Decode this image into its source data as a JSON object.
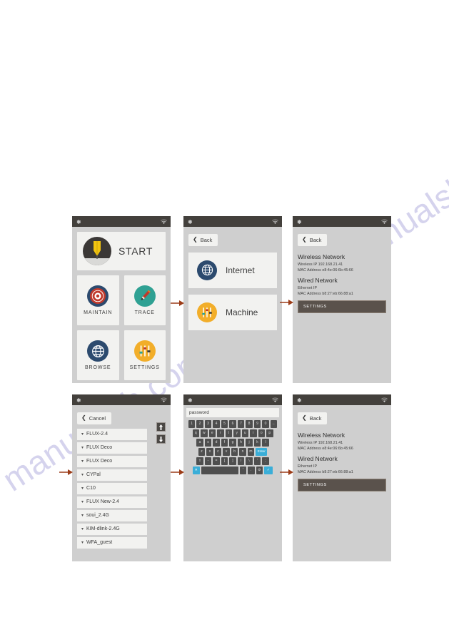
{
  "page": {
    "watermark_top": "manualslib.com",
    "watermark_bottom": "manualslib.com",
    "background": "#ffffff",
    "panel_bg": "#cfcfcf",
    "statusbar_bg": "#43403c",
    "accent_blue": "#3aaed8",
    "arrow_color": "#9c3c18"
  },
  "statusbar": {
    "gear_icon": "gear-icon",
    "wifi_icon": "wifi-icon"
  },
  "panel_home": {
    "name": "home-screen",
    "start": {
      "label": "START",
      "icon": "laser-head-icon"
    },
    "tiles": [
      {
        "label": "MAINTAIN",
        "icon": "target-icon",
        "color": "#2c4a6e"
      },
      {
        "label": "TRACE",
        "icon": "pencil-icon",
        "color": "#2fa193"
      },
      {
        "label": "BROWSE",
        "icon": "globe-icon",
        "color": "#2c4a6e"
      },
      {
        "label": "SETTINGS",
        "icon": "sliders-icon",
        "color": "#f2ae2a"
      }
    ]
  },
  "panel_menu": {
    "name": "network-type-screen",
    "back_label": "Back",
    "items": [
      {
        "label": "Internet",
        "icon": "globe-icon",
        "color": "#2c4a6e"
      },
      {
        "label": "Machine",
        "icon": "sliders-icon",
        "color": "#f2ae2a"
      }
    ]
  },
  "panel_info_top": {
    "name": "network-info-screen",
    "back_label": "Back",
    "wireless_heading": "Wireless Network",
    "wireless_ip": "Wireless IP 192.168.21.41",
    "wireless_mac": "MAC Address e8:4e:06:6b:45:66",
    "wired_heading": "Wired Network",
    "wired_ip": "Ethernet IP",
    "wired_mac": "MAC Address b8:27:eb:66:88:a1",
    "settings_label": "SETTINGS"
  },
  "panel_wifi_list": {
    "name": "wifi-list-screen",
    "cancel_label": "Cancel",
    "networks": [
      "FLUX-2.4",
      "FLUX Deco",
      "FLUX Deco",
      "CYPal",
      "C10",
      "FLUX New-2.4",
      "soui_2.4G",
      "KIM-dlink-2.4G",
      "WFA_guest"
    ],
    "scroll_up_icon": "arrow-up-icon",
    "scroll_down_icon": "arrow-down-icon"
  },
  "panel_keyboard": {
    "name": "password-keyboard-screen",
    "field_placeholder": "password",
    "field_value": "password",
    "rows": [
      [
        "1",
        "2",
        "3",
        "4",
        "5",
        "6",
        "7",
        "8",
        "9",
        "0",
        "←"
      ],
      [
        "q",
        "w",
        "e",
        "r",
        "t",
        "y",
        "u",
        "i",
        "o",
        "p"
      ],
      [
        "a",
        "s",
        "d",
        "f",
        "g",
        "h",
        "j",
        "k",
        "l"
      ],
      [
        "z",
        "x",
        "c",
        "v",
        "b",
        "n",
        "m",
        "Enter"
      ],
      [
        "⇧",
        "-",
        "=",
        "[",
        "]",
        "/",
        "\\",
        "'",
        ";"
      ],
      [
        "✕",
        "",
        "'",
        ".",
        "⚙",
        "✓"
      ]
    ],
    "enter_label": "Enter",
    "shift_icon": "shift-icon",
    "close_icon": "close-icon",
    "confirm_icon": "check-icon",
    "settings_key_icon": "gear-icon"
  },
  "panel_info_bottom": {
    "name": "network-info-screen-connected",
    "back_label": "Back",
    "wireless_heading": "Wireless Network",
    "wireless_ip": "Wireless IP 192.168.21.41",
    "wireless_mac": "MAC Address e8:4e:06:6b:45:66",
    "wired_heading": "Wired Network",
    "wired_ip": "Ethernet IP",
    "wired_mac": "MAC Address b8:27:eb:66:88:a1",
    "settings_label": "SETTINGS"
  }
}
